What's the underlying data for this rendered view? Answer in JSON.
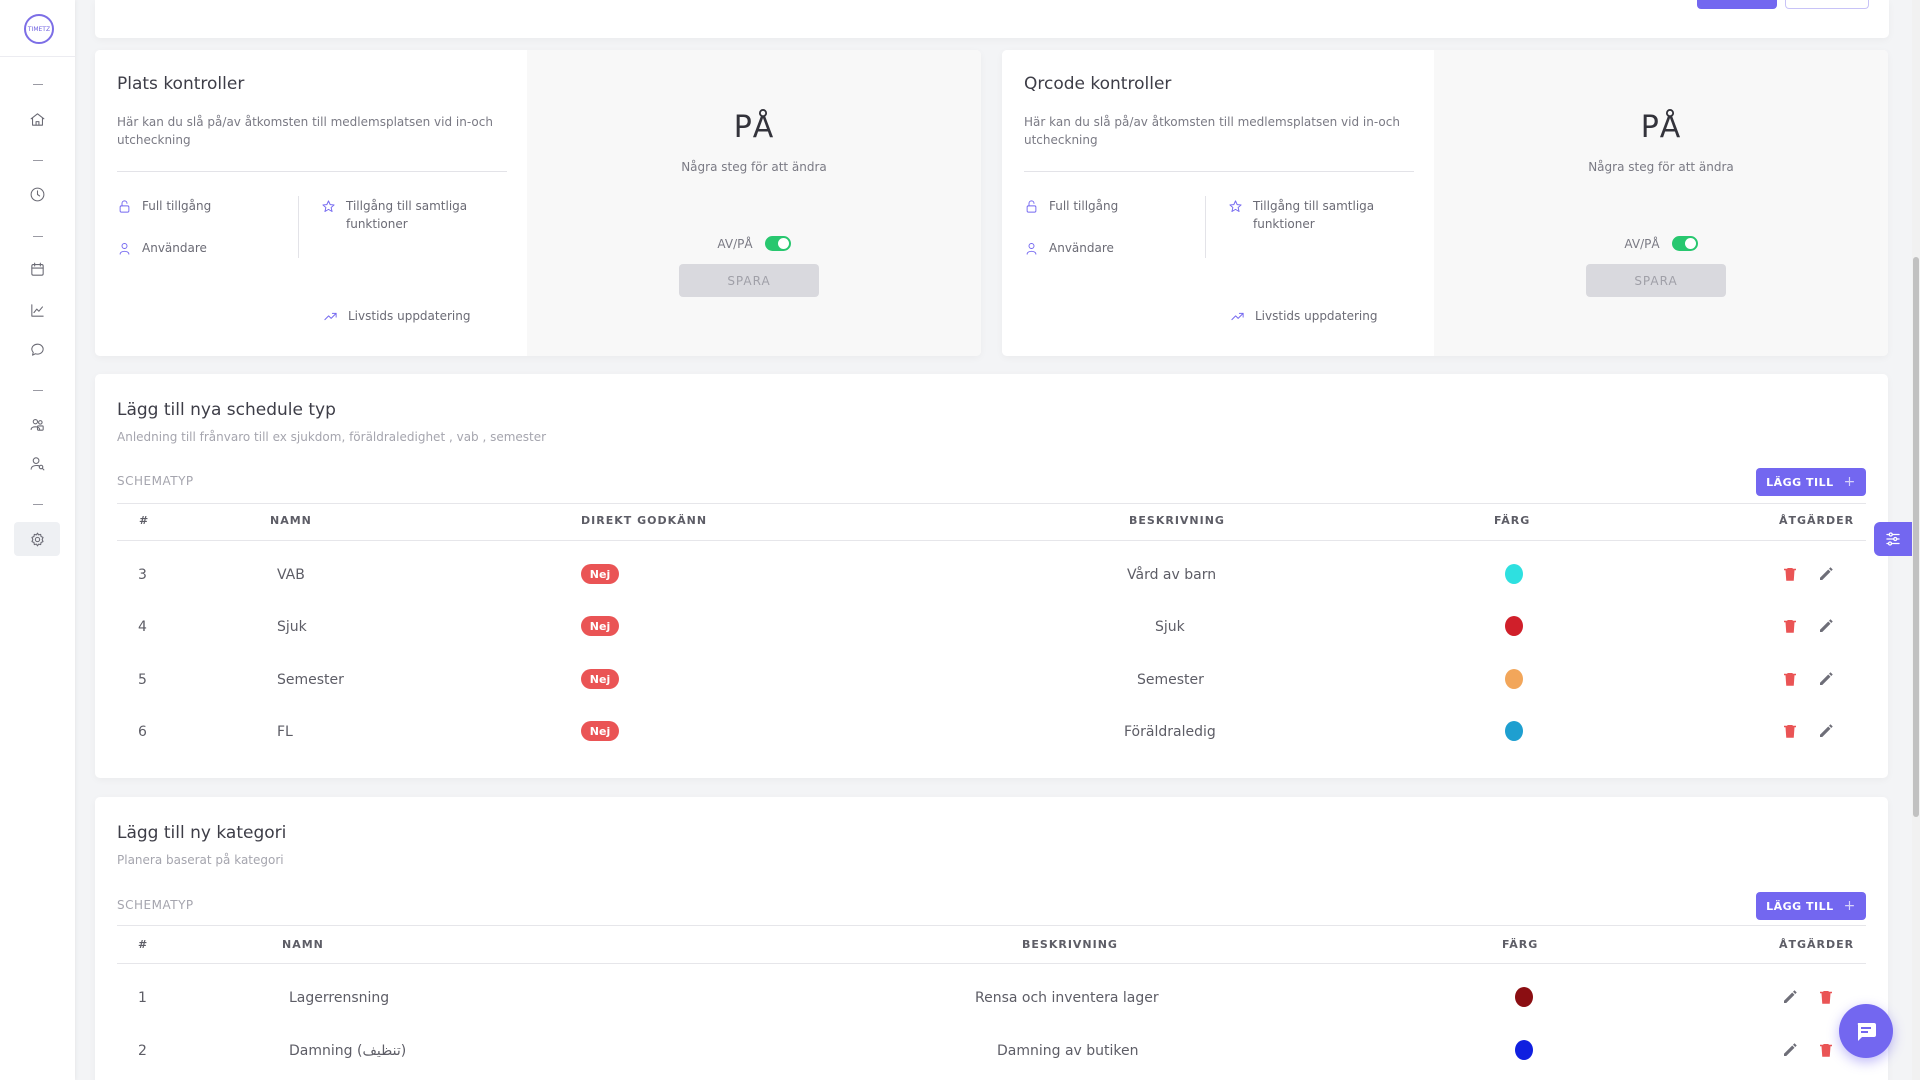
{
  "app": {
    "logo_text": "TIMETZ"
  },
  "place_control": {
    "title": "Plats kontroller",
    "description": "Här kan du slå på/av åtkomsten till medlemsplatsen vid in-och utcheckning",
    "features": {
      "full_access": "Full tillgång",
      "users": "Användare",
      "all_functions": "Tillgång till samtliga funktioner",
      "lifetime_update": "Livstids uppdatering"
    },
    "state": "PÅ",
    "state_hint": "Några steg för att ändra",
    "toggle_label": "AV/PÅ",
    "toggle_on": true,
    "save_label": "SPARA"
  },
  "qrcode_control": {
    "title": "Qrcode kontroller",
    "description": "Här kan du slå på/av åtkomsten till medlemsplatsen vid in-och utcheckning",
    "features": {
      "full_access": "Full tillgång",
      "users": "Användare",
      "all_functions": "Tillgång till samtliga funktioner",
      "lifetime_update": "Livstids uppdatering"
    },
    "state": "PÅ",
    "state_hint": "Några steg för att ändra",
    "toggle_label": "AV/PÅ",
    "toggle_on": true,
    "save_label": "SPARA"
  },
  "schedule_types": {
    "title": "Lägg till nya schedule typ",
    "subtitle": "Anledning till frånvaro till ex sjukdom, föräldraledighet , vab , semester",
    "section_label": "SCHEMATYP",
    "add_label": "LÄGG TILL",
    "columns": {
      "num": "#",
      "name": "NAMN",
      "approve": "DIREKT GODKÄNN",
      "desc": "BESKRIVNING",
      "color": "FÄRG",
      "actions": "ÅTGÄRDER"
    },
    "rows": [
      {
        "id": "3",
        "name": "VAB",
        "approve": "Nej",
        "description": "Vård av barn",
        "color": "#2ee0e0"
      },
      {
        "id": "4",
        "name": "Sjuk",
        "approve": "Nej",
        "description": "Sjuk",
        "color": "#d01f2a"
      },
      {
        "id": "5",
        "name": "Semester",
        "approve": "Nej",
        "description": "Semester",
        "color": "#f2a65a"
      },
      {
        "id": "6",
        "name": "FL",
        "approve": "Nej",
        "description": "Föräldraledig",
        "color": "#1e9fd0"
      }
    ]
  },
  "categories": {
    "title": "Lägg till ny kategori",
    "subtitle": "Planera baserat på kategori",
    "section_label": "SCHEMATYP",
    "add_label": "LÄGG TILL",
    "columns": {
      "num": "#",
      "name": "NAMN",
      "desc": "BESKRIVNING",
      "color": "FÄRG",
      "actions": "ÅTGÄRDER"
    },
    "rows": [
      {
        "id": "1",
        "name": "Lagerrensning",
        "description": "Rensa och inventera lager",
        "color": "#8b0e12"
      },
      {
        "id": "2",
        "name": "Damning (تنظيف)",
        "description": "Damning av butiken",
        "color": "#1020e0"
      }
    ]
  },
  "colors": {
    "accent": "#7367f0",
    "danger": "#ea5455",
    "success": "#28c76f"
  }
}
